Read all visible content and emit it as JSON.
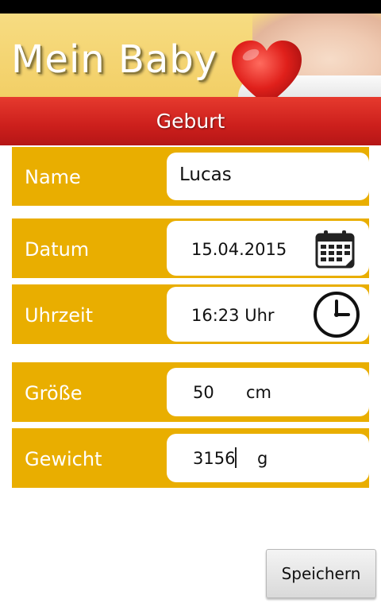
{
  "app": {
    "title": "Mein Baby"
  },
  "section": {
    "title": "Geburt"
  },
  "form": {
    "name": {
      "label": "Name",
      "value": "Lucas"
    },
    "datum": {
      "label": "Datum",
      "value": "15.04.2015",
      "icon": "calendar-icon"
    },
    "uhrzeit": {
      "label": "Uhrzeit",
      "value": "16:23 Uhr",
      "icon": "clock-icon"
    },
    "groesse": {
      "label": "Größe",
      "value": "50",
      "unit": "cm"
    },
    "gewicht": {
      "label": "Gewicht",
      "value": "3156",
      "unit": "g"
    }
  },
  "actions": {
    "save_label": "Speichern"
  },
  "colors": {
    "row_bg": "#e9ae00",
    "header_red": "#d0221e",
    "banner_yellow": "#f4d470"
  }
}
